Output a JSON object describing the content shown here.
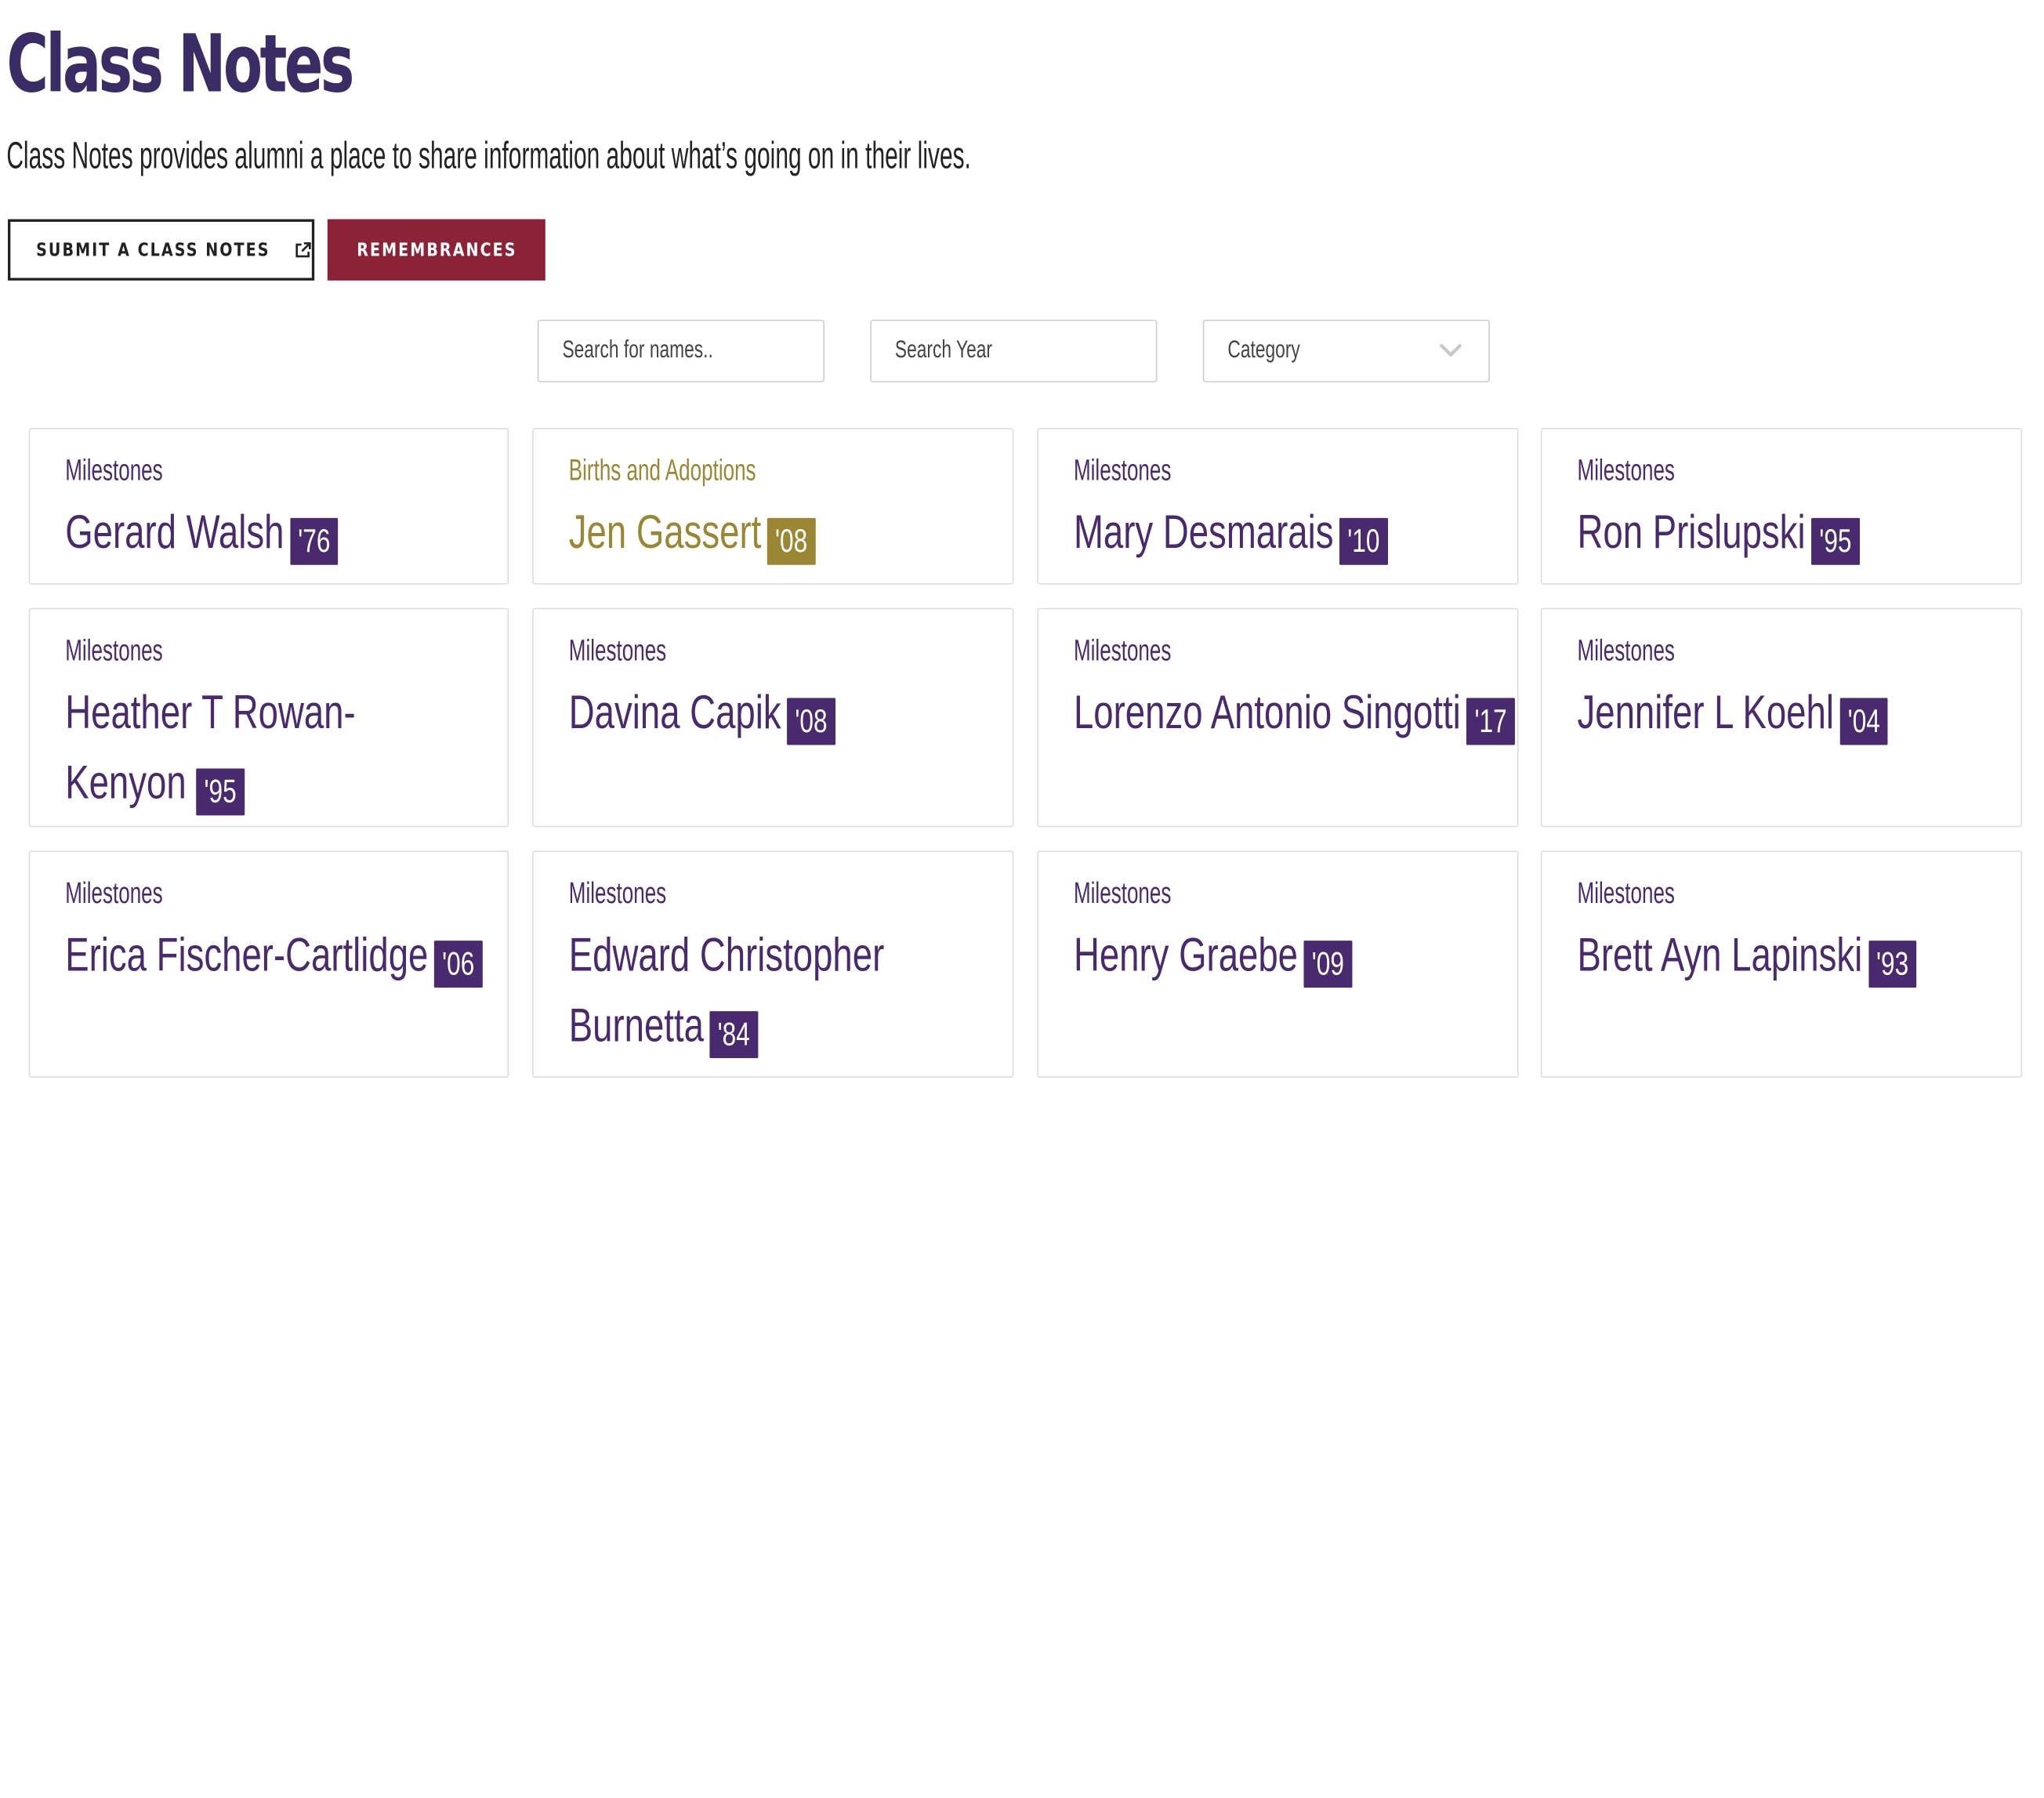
{
  "page": {
    "title": "Class Notes",
    "intro": "Class Notes provides alumni a place to share information about what’s going on in their lives."
  },
  "actions": {
    "submit_label": "SUBMIT A CLASS NOTES",
    "remembrances_label": "REMEMBRANCES"
  },
  "filters": {
    "name_placeholder": "Search for names..",
    "year_placeholder": "Search Year",
    "category_label": "Category"
  },
  "colors": {
    "brand_purple": "#4a2a6e",
    "title_purple": "#3a2d66",
    "remembrance_red": "#8b2235",
    "births_gold": "#9b8733"
  },
  "icons": {
    "external_link": "external-link-icon",
    "dropdown": "chevron-down-icon"
  },
  "notes": [
    {
      "category": "Milestones",
      "name": "Gerard Walsh",
      "year": "'76"
    },
    {
      "category": "Births and Adoptions",
      "name": "Jen Gassert",
      "year": "'08"
    },
    {
      "category": "Milestones",
      "name": "Mary Desmarais",
      "year": "'10"
    },
    {
      "category": "Milestones",
      "name": "Ron Prislupski",
      "year": "'95"
    },
    {
      "category": "Milestones",
      "name": "Heather T Rowan-Kenyon",
      "year": "'95"
    },
    {
      "category": "Milestones",
      "name": "Davina Capik",
      "year": "'08"
    },
    {
      "category": "Milestones",
      "name": "Lorenzo Antonio Singotti",
      "year": "'17"
    },
    {
      "category": "Milestones",
      "name": "Jennifer L Koehl",
      "year": "'04"
    },
    {
      "category": "Milestones",
      "name": "Erica Fischer-Cartlidge",
      "year": "'06"
    },
    {
      "category": "Milestones",
      "name": "Edward Christopher Burnetta",
      "year": "'84"
    },
    {
      "category": "Milestones",
      "name": "Henry Graebe",
      "year": "'09"
    },
    {
      "category": "Milestones",
      "name": "Brett Ayn Lapinski",
      "year": "'93"
    }
  ]
}
